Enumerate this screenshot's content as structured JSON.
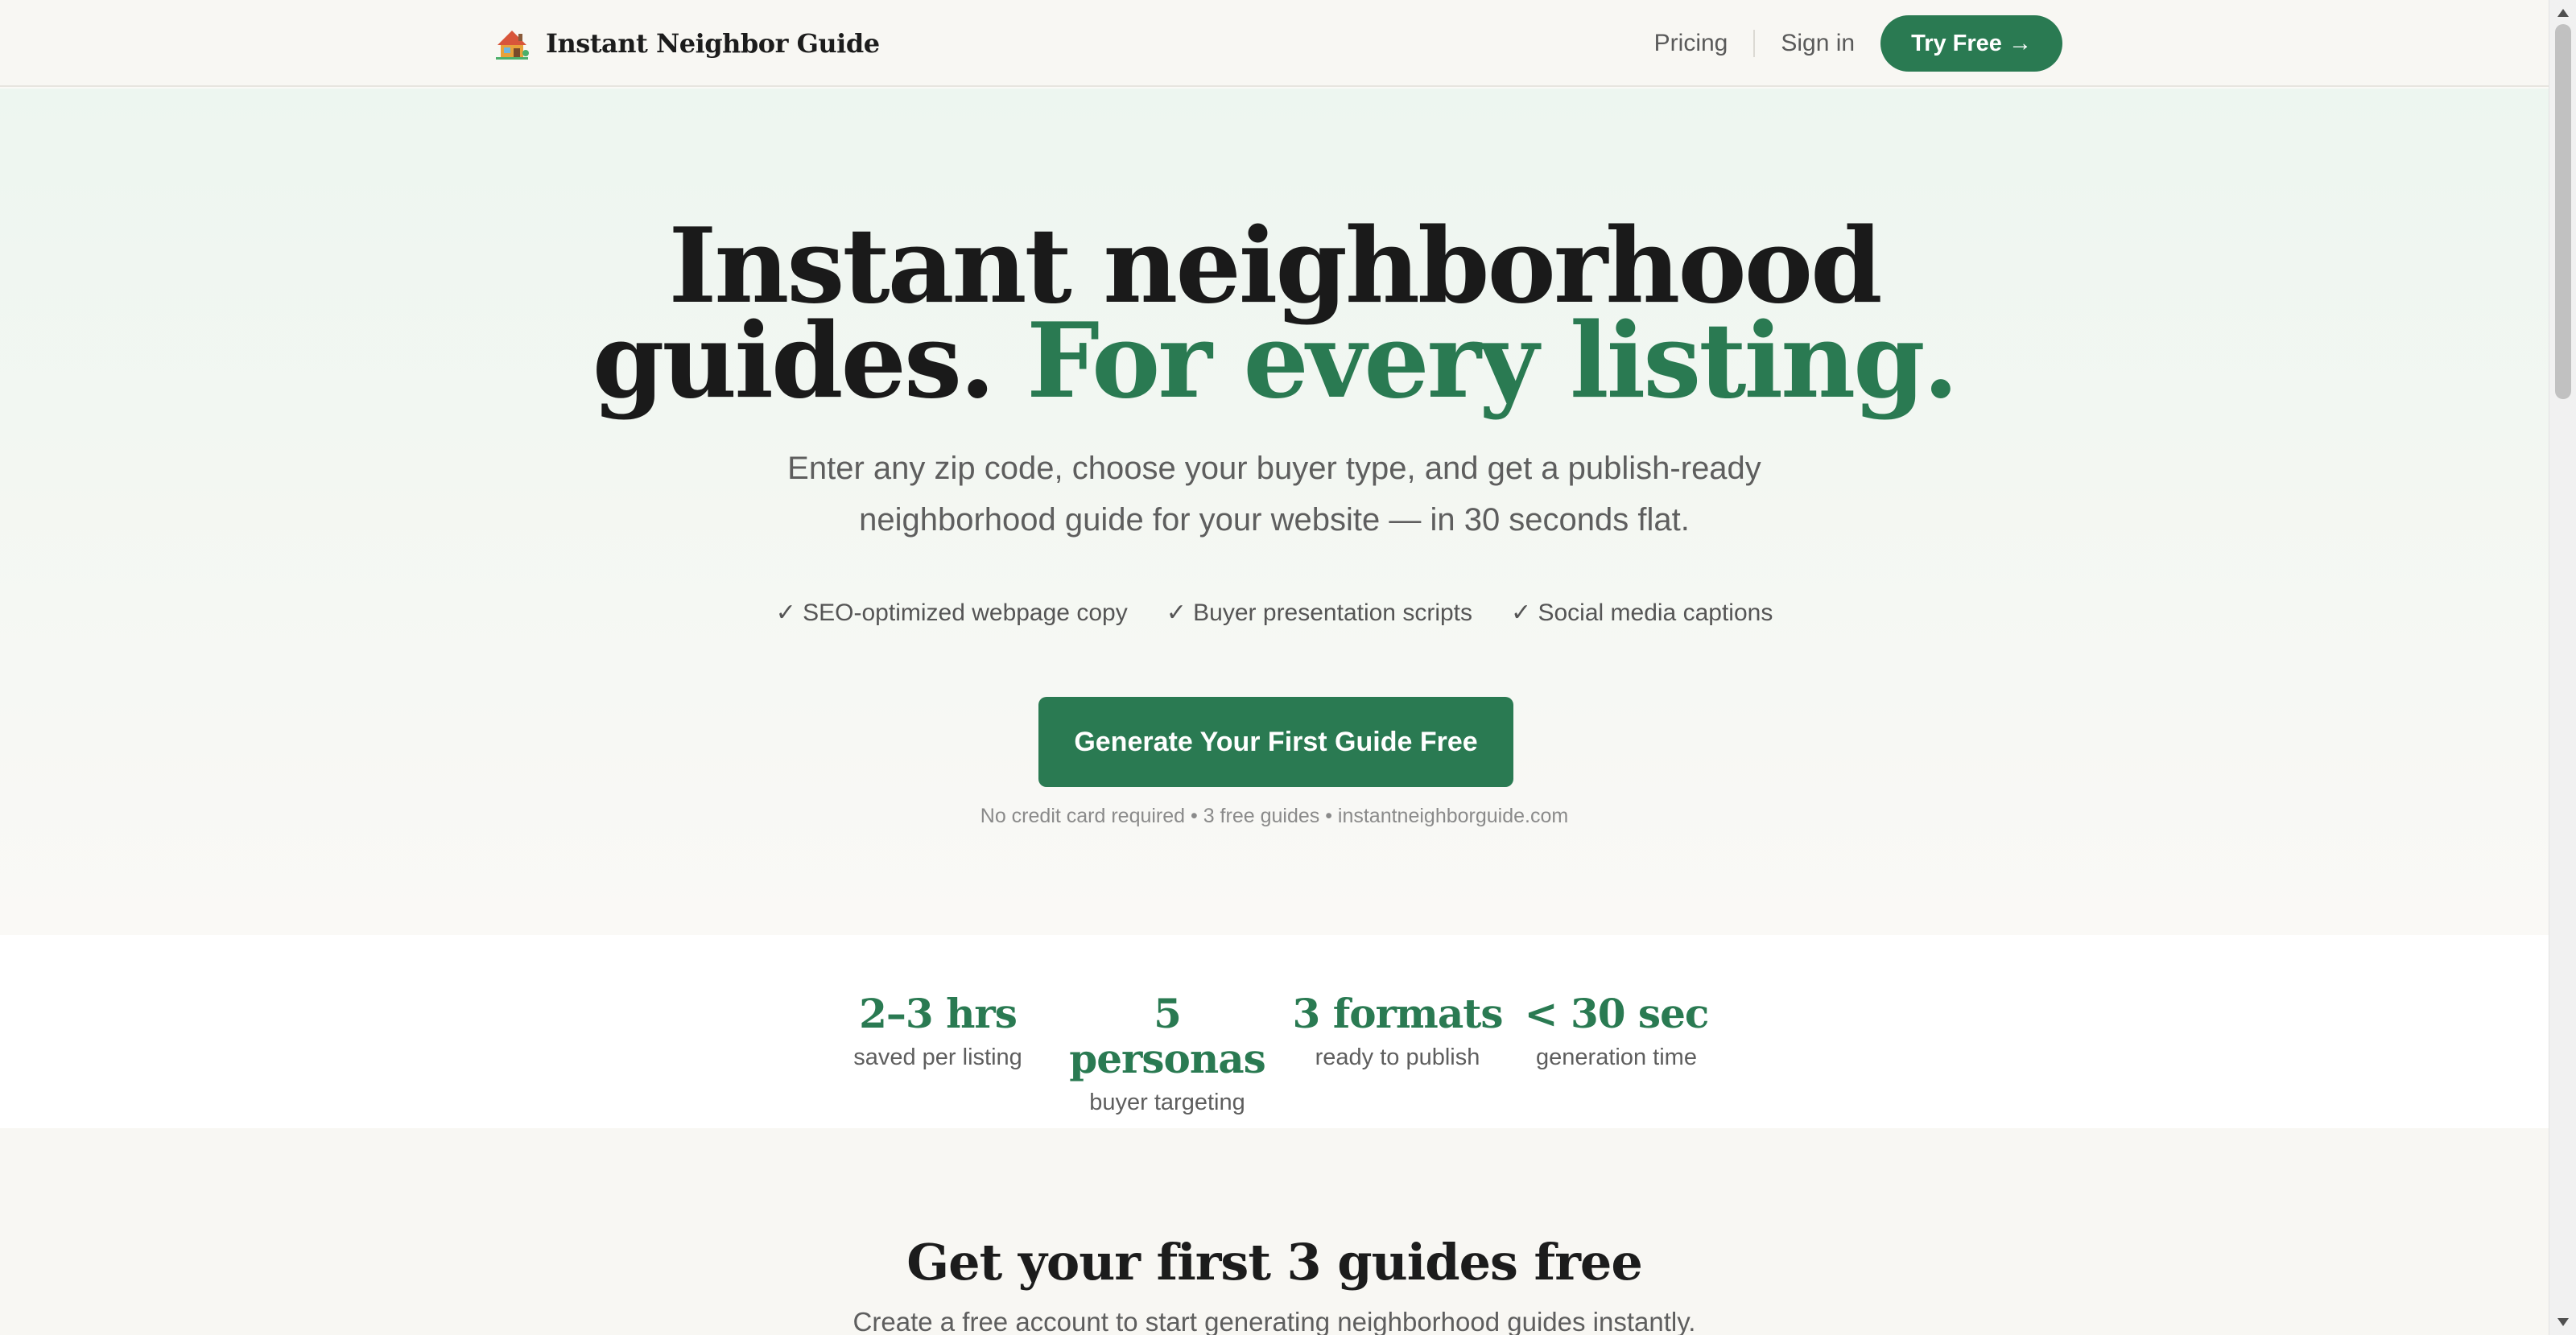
{
  "nav": {
    "brand_name": "Instant Neighbor Guide",
    "logo_icon": "house-icon",
    "links": {
      "pricing": "Pricing",
      "sign_in": "Sign in"
    },
    "try_free": "Try Free →"
  },
  "hero": {
    "title_line1": "Instant neighborhood",
    "title_line2_plain": "guides. ",
    "title_line2_accent": "For every listing.",
    "subtitle_line1": "Enter any zip code, choose your buyer type, and get a publish-ready",
    "subtitle_line2": "neighborhood guide for your website — in 30 seconds flat.",
    "features": [
      "✓ SEO-optimized webpage copy",
      "✓ Buyer presentation scripts",
      "✓ Social media captions"
    ],
    "cta": "Generate Your First Guide Free",
    "fineprint": "No credit card required • 3 free guides • instantneighborguide.com"
  },
  "stats": [
    {
      "value": "2–3 hrs",
      "label": "saved per listing"
    },
    {
      "value": "5 personas",
      "label": "buyer targeting"
    },
    {
      "value": "3 formats",
      "label": "ready to publish"
    },
    {
      "value": "< 30 sec",
      "label": "generation time"
    }
  ],
  "signup": {
    "title": "Get your first 3 guides free",
    "subtitle": "Create a free account to start generating neighborhood guides instantly."
  },
  "colors": {
    "accent": "#2a7a52",
    "text": "#1c1c1c",
    "muted": "#5e5e5e",
    "background": "#faf9f6"
  }
}
